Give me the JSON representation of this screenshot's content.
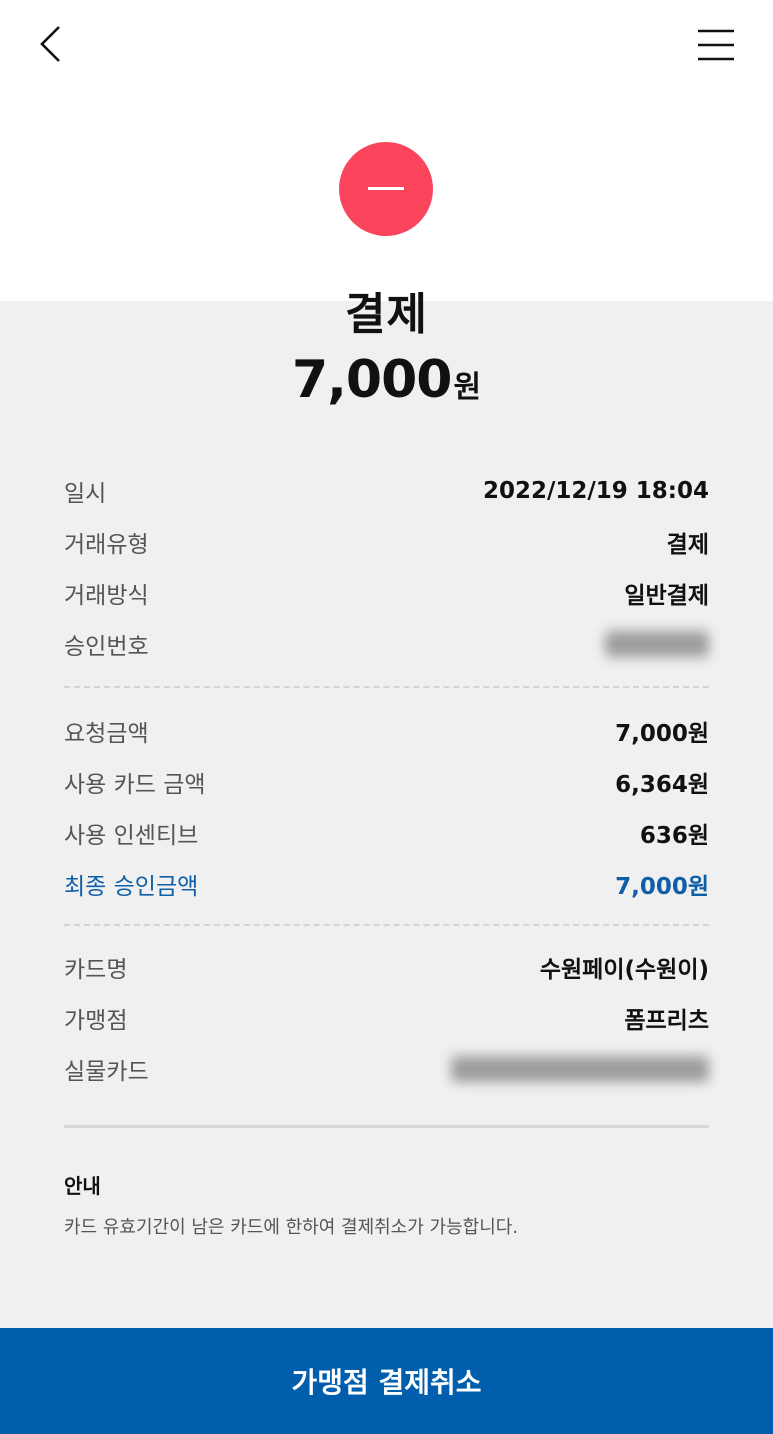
{
  "header": {
    "back_icon": "chevron-left-icon",
    "menu_icon": "hamburger-menu-icon"
  },
  "status": {
    "icon": "minus-icon",
    "color": "#fb455c"
  },
  "summary": {
    "title": "결제",
    "amount": "7,000",
    "unit": "원"
  },
  "section1": [
    {
      "label": "일시",
      "value": "2022/12/19 18:04"
    },
    {
      "label": "거래유형",
      "value": "결제"
    },
    {
      "label": "거래방식",
      "value": "일반결제"
    },
    {
      "label": "승인번호",
      "value": ""
    }
  ],
  "section2": [
    {
      "label": "요청금액",
      "value": "7,000원"
    },
    {
      "label": "사용 카드 금액",
      "value": "6,364원"
    },
    {
      "label": "사용 인센티브",
      "value": "636원"
    },
    {
      "label": "최종 승인금액",
      "value": "7,000원"
    }
  ],
  "section3": [
    {
      "label": "카드명",
      "value": "수원페이(수원이)"
    },
    {
      "label": "가맹점",
      "value": "폼프리츠"
    },
    {
      "label": "실물카드",
      "value": ""
    }
  ],
  "notice": {
    "title": "안내",
    "text": "카드 유효기간이 남은 카드에 한하여 결제취소가 가능합니다."
  },
  "footer": {
    "cancel_label": "가맹점 결제취소"
  },
  "colors": {
    "accent": "#005eac",
    "highlight": "#0e5fa8",
    "status": "#fb455c"
  }
}
